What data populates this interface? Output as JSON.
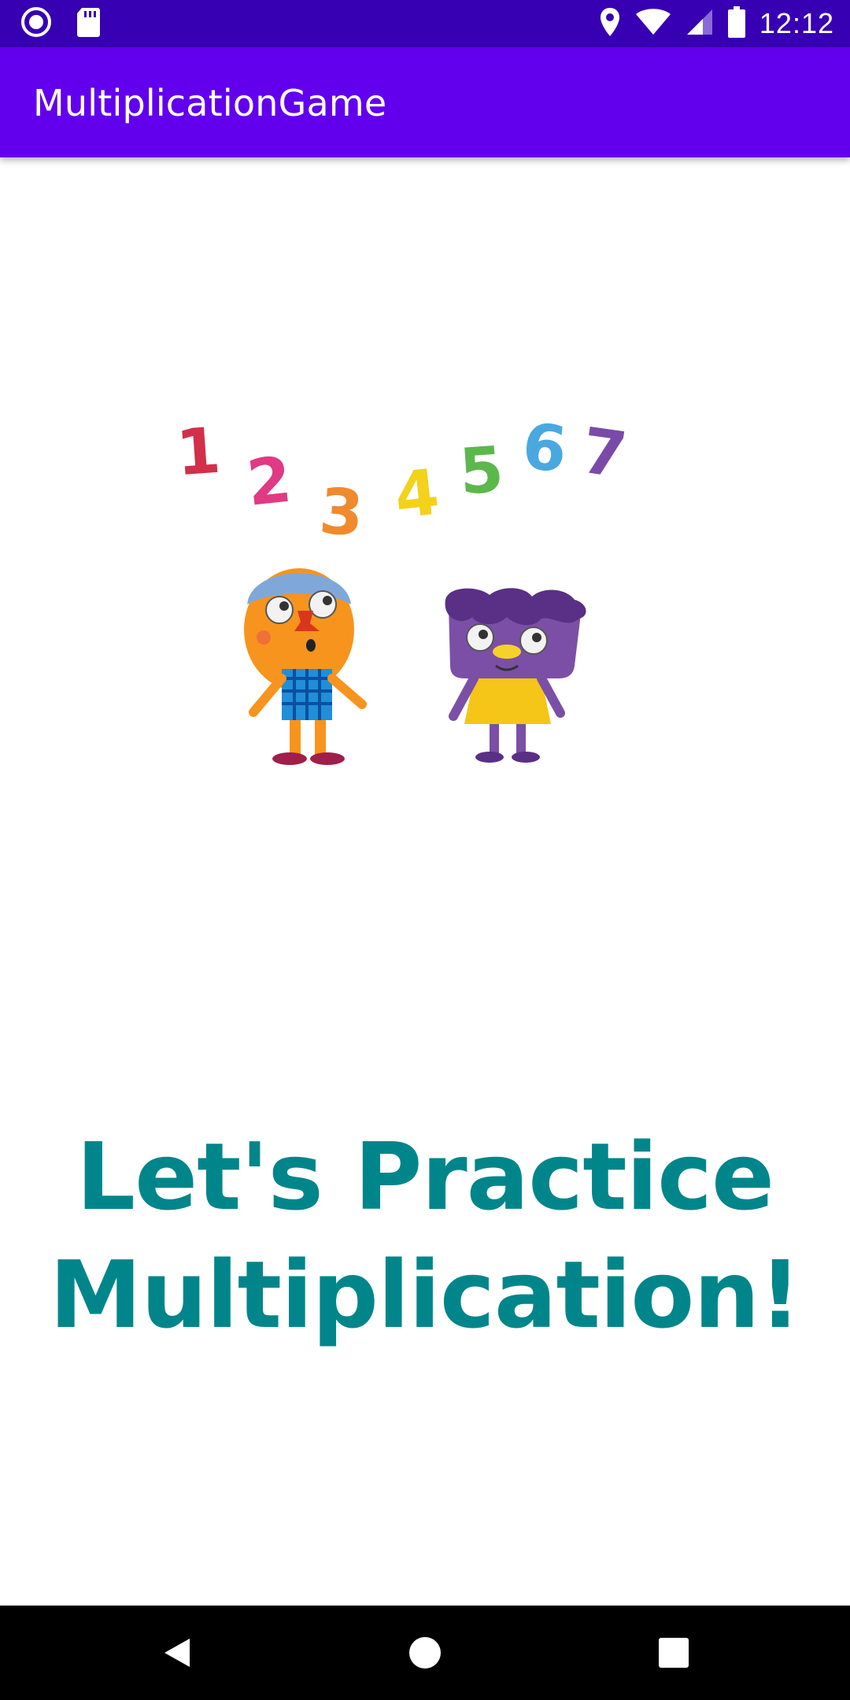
{
  "status_bar": {
    "time": "12:12",
    "icons": [
      "record-icon",
      "sd-card-icon",
      "location-icon",
      "wifi-icon",
      "signal-icon",
      "battery-icon"
    ]
  },
  "app_bar": {
    "title": "MultiplicationGame"
  },
  "illustration": {
    "description_icon": "kids-numbers-illustration",
    "numbers": [
      "1",
      "2",
      "3",
      "4",
      "5",
      "6",
      "7"
    ],
    "number_colors": [
      "#d22f4a",
      "#e03a84",
      "#f08a2c",
      "#f2d21a",
      "#5cb84a",
      "#4aa8e0",
      "#7a4aa8"
    ]
  },
  "main": {
    "heading_line1": "Let's Practice",
    "heading_line2": "Multiplication!"
  },
  "colors": {
    "status_bar": "#3700b3",
    "app_bar": "#6200ee",
    "heading": "#00868a"
  },
  "nav_bar": {
    "icons": [
      "back-icon",
      "home-icon",
      "recents-icon"
    ]
  }
}
